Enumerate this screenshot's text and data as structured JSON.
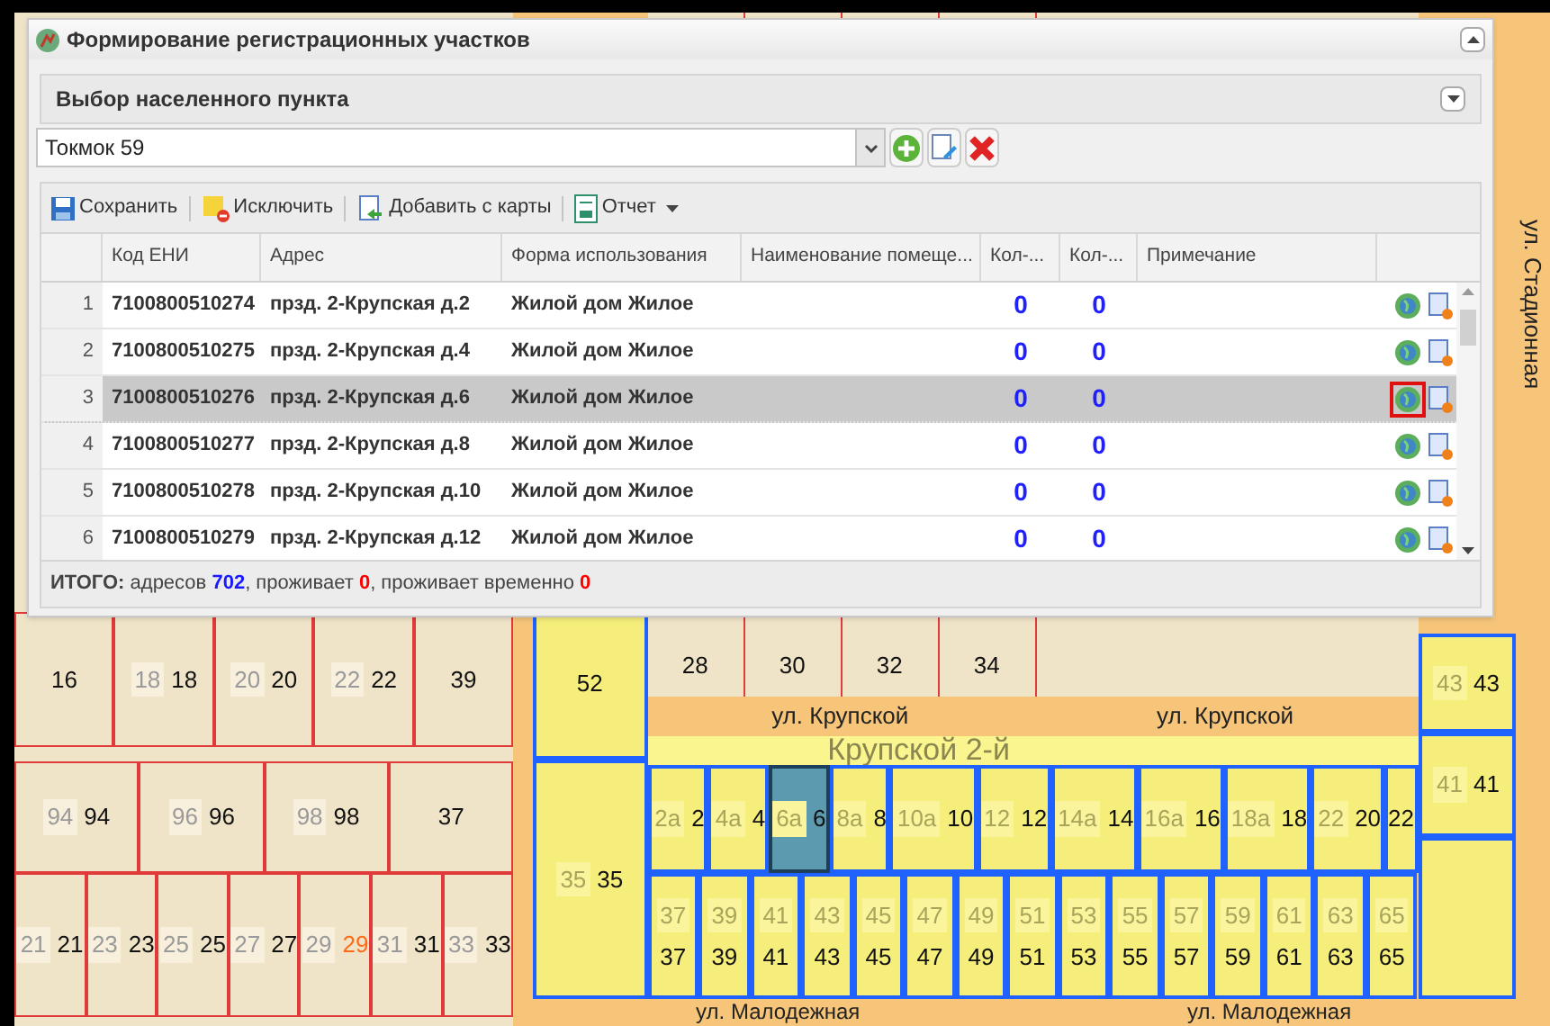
{
  "dialog": {
    "title": "Формирование регистрационных участков",
    "locality": {
      "title": "Выбор населенного пункта",
      "value": "Токмок 59"
    },
    "toolbar": [
      {
        "kind": "save",
        "label": "Сохранить"
      },
      {
        "kind": "exclude",
        "label": "Исключить"
      },
      {
        "kind": "add",
        "label": "Добавить с карты"
      },
      {
        "kind": "report",
        "label": "Отчет",
        "menu": true
      }
    ],
    "columns": [
      "Код ЕНИ",
      "Адрес",
      "Форма использования",
      "Наименование помеще...",
      "Кол-...",
      "Кол-...",
      "Примечание"
    ],
    "rows": [
      {
        "num": "1",
        "code": "7100800510274",
        "address": "прзд. 2-Крупская д.2",
        "usage": "Жилой дом Жилое",
        "count_1": "0",
        "count_2": "0",
        "selected": false,
        "marked": false
      },
      {
        "num": "2",
        "code": "7100800510275",
        "address": "прзд. 2-Крупская д.4",
        "usage": "Жилой дом Жилое",
        "count_1": "0",
        "count_2": "0",
        "selected": false,
        "marked": false
      },
      {
        "num": "3",
        "code": "7100800510276",
        "address": "прзд. 2-Крупская д.6",
        "usage": "Жилой дом Жилое",
        "count_1": "0",
        "count_2": "0",
        "selected": true,
        "marked": true
      },
      {
        "num": "4",
        "code": "7100800510277",
        "address": "прзд. 2-Крупская д.8",
        "usage": "Жилой дом Жилое",
        "count_1": "0",
        "count_2": "0",
        "selected": false,
        "marked": false
      },
      {
        "num": "5",
        "code": "7100800510278",
        "address": "прзд. 2-Крупская д.10",
        "usage": "Жилой дом Жилое",
        "count_1": "0",
        "count_2": "0",
        "selected": false,
        "marked": false
      },
      {
        "num": "6",
        "code": "7100800510279",
        "address": "прзд. 2-Крупская д.12",
        "usage": "Жилой дом Жилое",
        "count_1": "0",
        "count_2": "0",
        "selected": false,
        "marked": false
      }
    ],
    "summary": {
      "label": "ИТОГО:",
      "items": [
        {
          "text": "адресов",
          "value": "702",
          "color": "#1a1aff"
        },
        {
          "text": ", проживает",
          "value": "0",
          "color": "#ff0000"
        },
        {
          "text": ", проживает временно",
          "value": "0",
          "color": "#ff0000"
        }
      ]
    }
  },
  "map": {
    "west_rows": [
      [
        {
          "n": "16"
        },
        {
          "n": "18",
          "tag": "18"
        },
        {
          "n": "20",
          "tag": "20"
        },
        {
          "n": "22",
          "tag": "22"
        },
        {
          "n": "39"
        }
      ],
      [
        {
          "n": "94",
          "tag": "94"
        },
        {
          "n": "96",
          "tag": "96"
        },
        {
          "n": "98",
          "tag": "98"
        },
        {
          "n": "37"
        }
      ],
      [
        {
          "n": "21",
          "tag": "21"
        },
        {
          "n": "23",
          "tag": "23"
        },
        {
          "n": "25",
          "tag": "25"
        },
        {
          "n": "27",
          "tag": "27"
        },
        {
          "n": "29",
          "tag": "29",
          "color": "#ff6a1a"
        },
        {
          "n": "31",
          "tag": "31"
        },
        {
          "n": "33",
          "tag": "33"
        }
      ]
    ],
    "north_row": [
      {
        "n": "28"
      },
      {
        "n": "30"
      },
      {
        "n": "32"
      },
      {
        "n": "34"
      }
    ],
    "street_north": [
      "ул. Крупской",
      "ул. Крупской"
    ],
    "lane": "Крупской 2-й",
    "west_column": [
      {
        "n": "52",
        "selected": false
      },
      {
        "n": "35",
        "tag": "35",
        "selected": false
      }
    ],
    "top_row": [
      {
        "n": "2",
        "tag": "2а",
        "selected": false
      },
      {
        "n": "4",
        "tag": "4а",
        "selected": false
      },
      {
        "n": "6",
        "tag": "6а",
        "selected": true
      },
      {
        "n": "8",
        "tag": "8а",
        "selected": false
      },
      {
        "n": "10",
        "tag": "10а",
        "selected": false
      },
      {
        "n": "12",
        "tag": "12",
        "selected": false
      },
      {
        "n": "14",
        "tag": "14а",
        "selected": false
      },
      {
        "n": "16",
        "tag": "16а",
        "selected": false
      },
      {
        "n": "18",
        "tag": "18а",
        "selected": false
      },
      {
        "n": "20",
        "tag": "22",
        "selected": false
      },
      {
        "n": "22",
        "selected": false
      }
    ],
    "bottom_row": [
      {
        "n": "37",
        "tag": "37",
        "selected": false
      },
      {
        "n": "39",
        "tag": "39",
        "selected": false
      },
      {
        "n": "41",
        "tag": "41",
        "selected": false
      },
      {
        "n": "43",
        "tag": "43",
        "selected": false
      },
      {
        "n": "45",
        "tag": "45",
        "selected": false
      },
      {
        "n": "47",
        "tag": "47",
        "selected": false
      },
      {
        "n": "49",
        "tag": "49",
        "selected": false
      },
      {
        "n": "51",
        "tag": "51",
        "selected": false
      },
      {
        "n": "53",
        "tag": "53",
        "selected": false
      },
      {
        "n": "55",
        "tag": "55",
        "selected": false
      },
      {
        "n": "57",
        "tag": "57",
        "selected": false
      },
      {
        "n": "59",
        "tag": "59",
        "selected": false
      },
      {
        "n": "61",
        "tag": "61",
        "selected": false
      },
      {
        "n": "63",
        "tag": "63",
        "selected": false
      },
      {
        "n": "65",
        "tag": "65",
        "selected": false
      }
    ],
    "east_column": [
      {
        "n": "43",
        "tag": "43",
        "selected": false
      },
      {
        "n": "41",
        "tag": "41",
        "selected": false
      }
    ],
    "street_south": [
      "ул. Малодежная",
      "ул. Малодежная"
    ],
    "street_east": "ул. Стадионная"
  }
}
